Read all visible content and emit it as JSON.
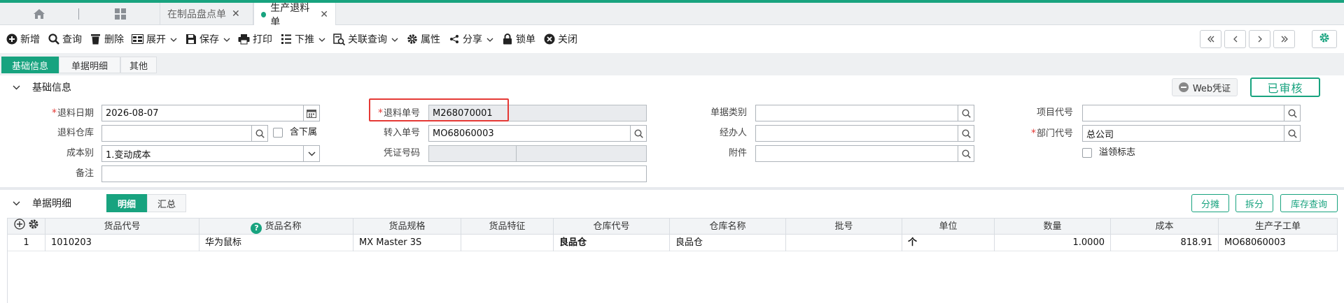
{
  "tabs": {
    "items": [
      {
        "label": "在制品盘点单",
        "active": false
      },
      {
        "label": "生产退料单",
        "active": true
      }
    ]
  },
  "toolbar": {
    "new": "新增",
    "query": "查询",
    "delete": "删除",
    "expand": "展开",
    "save": "保存",
    "print": "打印",
    "push_down": "下推",
    "linked_query": "关联查询",
    "properties": "属性",
    "share": "分享",
    "lock": "锁单",
    "close": "关闭"
  },
  "subtabs": [
    "基础信息",
    "单据明细",
    "其他"
  ],
  "basic": {
    "section_title": "基础信息",
    "web_voucher": "Web凭证",
    "status": "已审核",
    "fields": {
      "return_date": {
        "label": "退料日期",
        "value": "2026-08-07"
      },
      "return_no": {
        "label": "退料单号",
        "value": "M268070001"
      },
      "doc_type": {
        "label": "单据类别",
        "value": ""
      },
      "project_code": {
        "label": "项目代号",
        "value": ""
      },
      "return_warehouse": {
        "label": "退料仓库",
        "value": ""
      },
      "include_sub": {
        "label": "含下属"
      },
      "transfer_no": {
        "label": "转入单号",
        "value": "MO68060003"
      },
      "handler": {
        "label": "经办人",
        "value": ""
      },
      "dept_code": {
        "label": "部门代号",
        "value": "总公司"
      },
      "cost_type": {
        "label": "成本别",
        "value": "1.变动成本"
      },
      "voucher_no": {
        "label": "凭证号码",
        "value": ""
      },
      "attachment": {
        "label": "附件",
        "value": ""
      },
      "overdraw": {
        "label": "溢领标志"
      },
      "remark": {
        "label": "备注",
        "value": ""
      }
    }
  },
  "detail": {
    "section_title": "单据明细",
    "toggle": [
      "明细",
      "汇总"
    ],
    "buttons": {
      "allocate": "分摊",
      "split": "拆分",
      "stock_query": "库存查询"
    },
    "columns": [
      "货品代号",
      "货品名称",
      "货品规格",
      "货品特征",
      "仓库代号",
      "仓库名称",
      "批号",
      "单位",
      "数量",
      "成本",
      "生产子工单"
    ],
    "rows": [
      {
        "no": "1",
        "item_code": "1010203",
        "item_name": "华为鼠标",
        "spec": "MX Master 3S",
        "feature": "",
        "wh_code": "良品仓",
        "wh_name": "良品仓",
        "batch": "",
        "unit": "个",
        "qty": "1.0000",
        "cost": "818.91",
        "sub_order": "MO68060003"
      }
    ]
  },
  "colors": {
    "accent": "#18a37f",
    "highlight": "#e53935"
  }
}
